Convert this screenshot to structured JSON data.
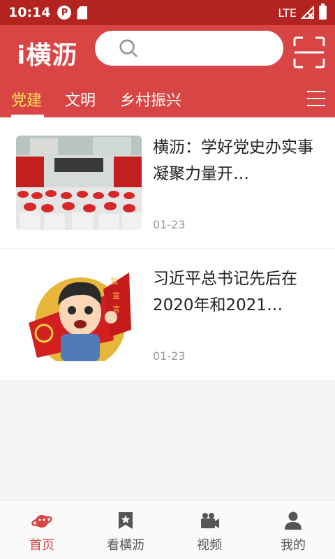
{
  "status_bar": {
    "time": "10:14",
    "network": "LTE"
  },
  "app": {
    "logo_text": "i横沥"
  },
  "search": {
    "placeholder": ""
  },
  "tabs": [
    {
      "label": "党建",
      "active": true
    },
    {
      "label": "文明",
      "active": false
    },
    {
      "label": "乡村振兴",
      "active": false
    }
  ],
  "news": [
    {
      "title": "横沥：学好党史办实事 凝聚力量开…",
      "date": "01-23"
    },
    {
      "title": "习近平总书记先后在2020年和2021…",
      "date": "01-23"
    }
  ],
  "bottom_nav": [
    {
      "label": "首页",
      "icon": "planet-icon",
      "active": true
    },
    {
      "label": "看横沥",
      "icon": "bookmark-star-icon",
      "active": false
    },
    {
      "label": "视频",
      "icon": "video-camera-icon",
      "active": false
    },
    {
      "label": "我的",
      "icon": "person-icon",
      "active": false
    }
  ],
  "colors": {
    "header": "#d84544",
    "status_bar": "#b3231f",
    "active_tab": "#ffe45c",
    "accent": "#d84544"
  }
}
